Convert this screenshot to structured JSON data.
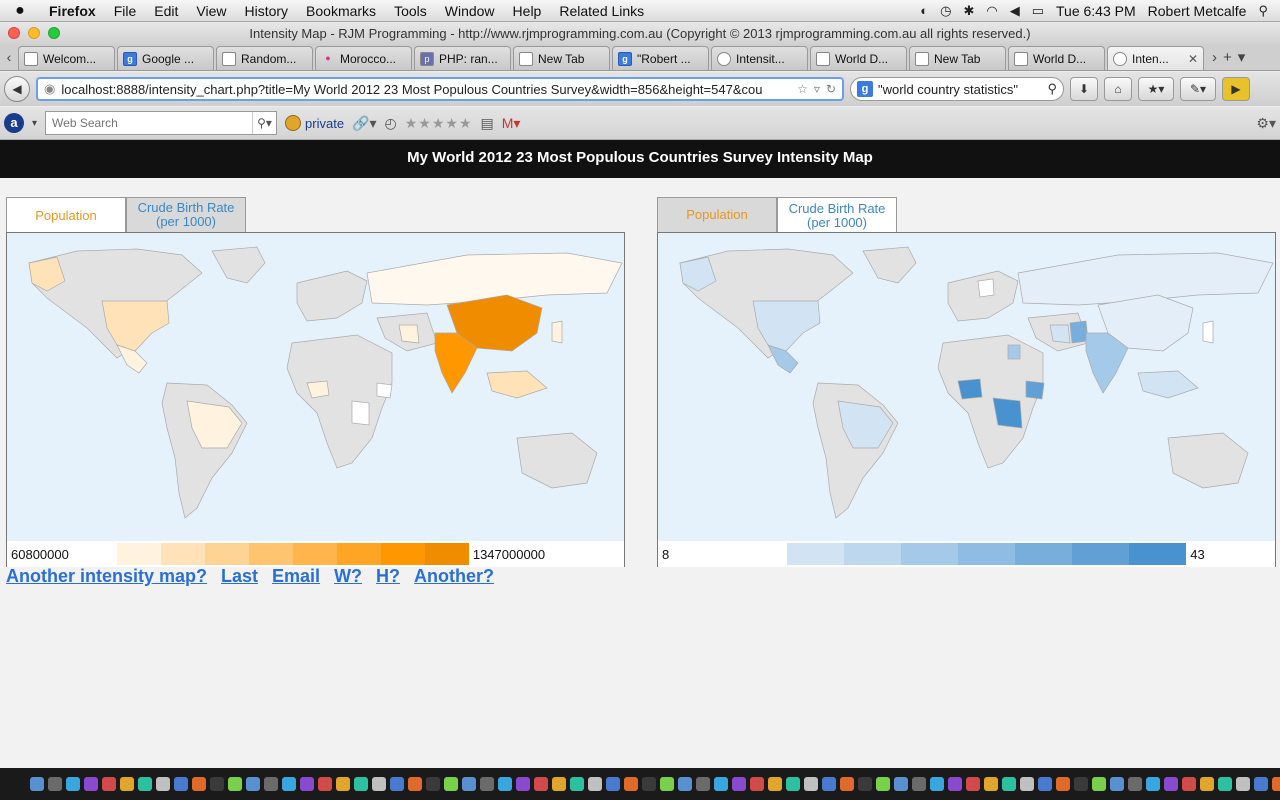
{
  "menubar": {
    "app": "Firefox",
    "items": [
      "File",
      "Edit",
      "View",
      "History",
      "Bookmarks",
      "Tools",
      "Window",
      "Help",
      "Related Links"
    ],
    "clock": "Tue 6:43 PM",
    "user": "Robert Metcalfe"
  },
  "window": {
    "title": "Intensity Map - RJM Programming - http://www.rjmprogramming.com.au (Copyright © 2013 rjmprogramming.com.au all rights reserved.)"
  },
  "tabs": [
    {
      "label": "Welcom...",
      "icon": "page-icon"
    },
    {
      "label": "Google ...",
      "icon": "google-icon"
    },
    {
      "label": "Random...",
      "icon": "page-icon"
    },
    {
      "label": "Morocco...",
      "icon": "flickr-icon"
    },
    {
      "label": "PHP: ran...",
      "icon": "php-icon"
    },
    {
      "label": "New Tab",
      "icon": "page-icon"
    },
    {
      "label": "\"Robert ...",
      "icon": "google-icon"
    },
    {
      "label": "Intensit...",
      "icon": "globe-icon"
    },
    {
      "label": "World D...",
      "icon": "page-icon"
    },
    {
      "label": "New Tab",
      "icon": "page-icon"
    },
    {
      "label": "World D...",
      "icon": "page-icon"
    },
    {
      "label": "Inten...",
      "icon": "globe-icon",
      "active": true
    }
  ],
  "navbar": {
    "url": "localhost:8888/intensity_chart.php?title=My World 2012 23 Most Populous Countries Survey&width=856&height=547&cou",
    "search": "\"world country statistics\""
  },
  "toolbar2": {
    "web_search_placeholder": "Web Search",
    "private_label": "private"
  },
  "page": {
    "header": "My World 2012 23 Most Populous Countries Survey Intensity Map",
    "tab_population": "Population",
    "tab_cbr": "Crude Birth Rate (per 1000)",
    "left_legend": {
      "min": "60800000",
      "max": "1347000000"
    },
    "right_legend": {
      "min": "8",
      "max": "43"
    },
    "links": [
      "Another intensity map?",
      "Last",
      "Email",
      "W?",
      "H?",
      "Another?"
    ]
  },
  "colors": {
    "pop_ramp": [
      "#ffffff",
      "#fff2de",
      "#ffe2b8",
      "#ffd394",
      "#ffc470",
      "#ffb54b",
      "#ffa526",
      "#ff9700",
      "#f08c00"
    ],
    "cbr_ramp": [
      "#ffffff",
      "#ffffff",
      "#d2e4f3",
      "#bcd7ee",
      "#a5c9e8",
      "#8ebce2",
      "#77aedc",
      "#60a0d5",
      "#4892cf"
    ],
    "ocean": "#e6f2fb",
    "land": "#e2e2e2"
  }
}
